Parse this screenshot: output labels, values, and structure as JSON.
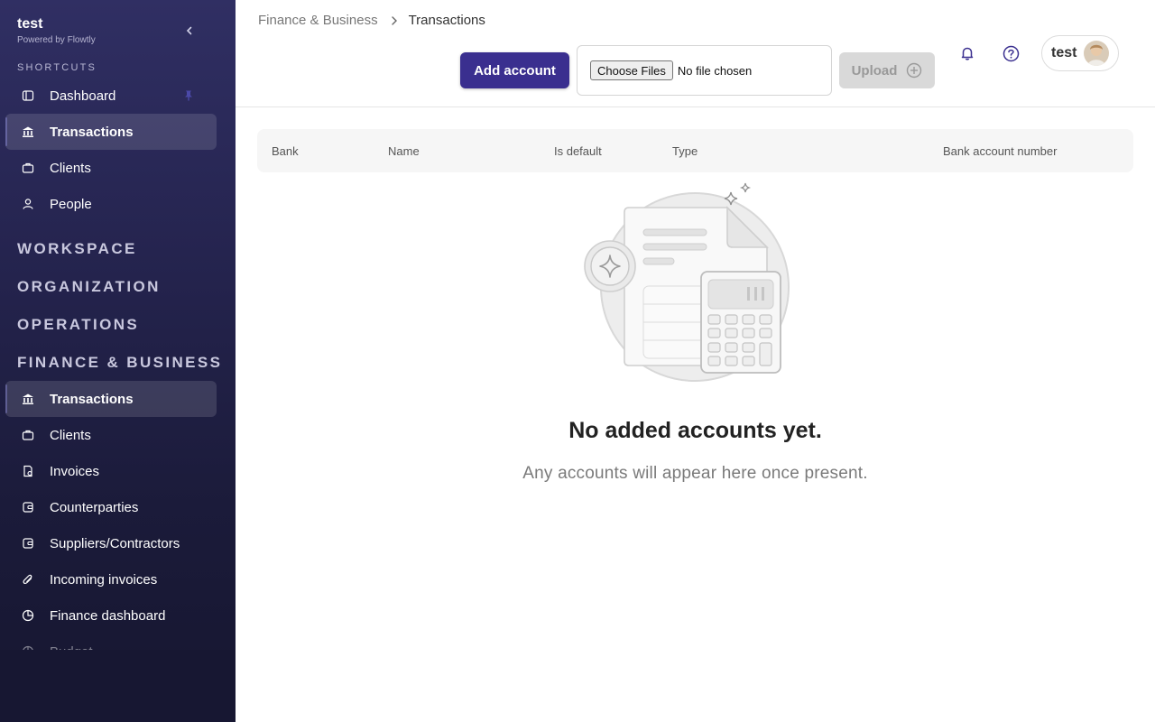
{
  "sidebar": {
    "brand": {
      "title": "test",
      "subtitle": "Powered by Flowtly"
    },
    "shortcuts_label": "SHORTCUTS",
    "shortcuts": [
      {
        "label": "Dashboard",
        "icon": "layout-icon"
      },
      {
        "label": "Transactions",
        "icon": "bank-icon"
      },
      {
        "label": "Clients",
        "icon": "briefcase-icon"
      },
      {
        "label": "People",
        "icon": "user-icon"
      }
    ],
    "sections": [
      "WORKSPACE",
      "ORGANIZATION",
      "OPERATIONS",
      "FINANCE & BUSINESS"
    ],
    "finance_items": [
      {
        "label": "Transactions",
        "icon": "bank-icon"
      },
      {
        "label": "Clients",
        "icon": "briefcase-icon"
      },
      {
        "label": "Invoices",
        "icon": "invoice-icon"
      },
      {
        "label": "Counterparties",
        "icon": "wallet-icon"
      },
      {
        "label": "Suppliers/Contractors",
        "icon": "wallet-icon"
      },
      {
        "label": "Incoming invoices",
        "icon": "paperclip-icon"
      },
      {
        "label": "Finance dashboard",
        "icon": "pie-chart-icon"
      },
      {
        "label": "Budget",
        "icon": "pie-chart-icon"
      }
    ]
  },
  "breadcrumb": {
    "parent": "Finance & Business",
    "current": "Transactions"
  },
  "toolbar": {
    "add_label": "Add account",
    "file_button": "Choose Files",
    "file_status": "No file chosen",
    "upload_label": "Upload"
  },
  "user": {
    "name": "test"
  },
  "table": {
    "columns": [
      "Bank",
      "Name",
      "Is default",
      "Type",
      "Bank account number"
    ]
  },
  "empty": {
    "title": "No added accounts yet.",
    "subtitle": "Any accounts will appear here once present."
  },
  "colors": {
    "accent": "#3a2f8f",
    "sidebar_top": "#302f63",
    "sidebar_bottom": "#161630"
  }
}
